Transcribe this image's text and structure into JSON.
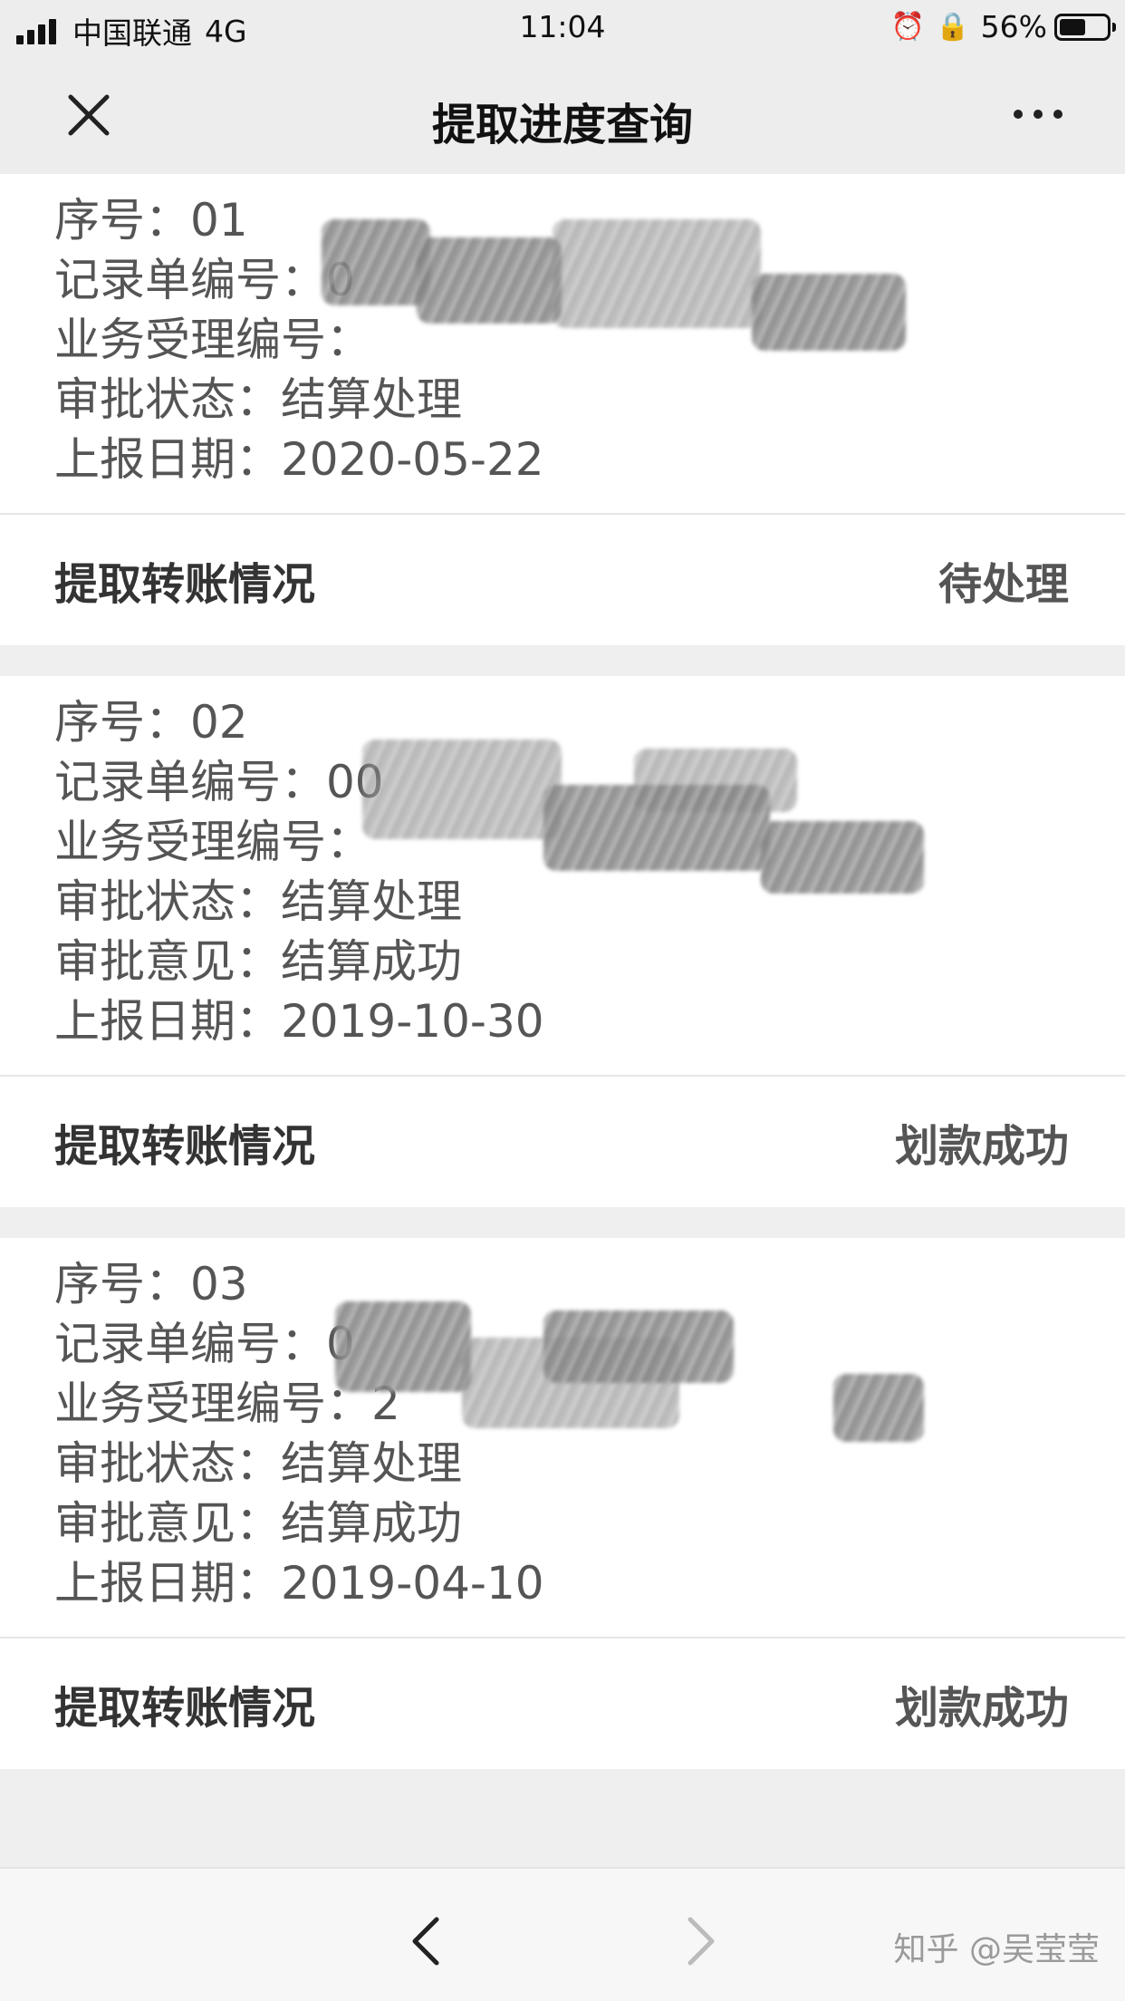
{
  "status_bar": {
    "carrier": "中国联通",
    "network": "4G",
    "time": "11:04",
    "battery_percent_text": "56%",
    "battery_level": 0.56,
    "icons": [
      "signal-icon",
      "alarm-icon",
      "rotation-lock-icon",
      "battery-icon"
    ]
  },
  "nav": {
    "title": "提取进度查询",
    "close_icon": "close-icon",
    "more_icon": "more-icon"
  },
  "records": [
    {
      "fields": [
        {
          "key": "序号：",
          "value": "01"
        },
        {
          "key": "记录单编号：",
          "value": "0"
        },
        {
          "key": "业务受理编号：",
          "value": ""
        },
        {
          "key": "审批状态：",
          "value": "结算处理"
        },
        {
          "key": "上报日期：",
          "value": "2020-05-22"
        }
      ],
      "transfer_label": "提取转账情况",
      "transfer_status": "待处理"
    },
    {
      "fields": [
        {
          "key": "序号：",
          "value": "02"
        },
        {
          "key": "记录单编号：",
          "value": "00"
        },
        {
          "key": "业务受理编号：",
          "value": ""
        },
        {
          "key": "审批状态：",
          "value": "结算处理"
        },
        {
          "key": "审批意见：",
          "value": "结算成功"
        },
        {
          "key": "上报日期：",
          "value": "2019-10-30"
        }
      ],
      "transfer_label": "提取转账情况",
      "transfer_status": "划款成功"
    },
    {
      "fields": [
        {
          "key": "序号：",
          "value": "03"
        },
        {
          "key": "记录单编号：",
          "value": "0"
        },
        {
          "key": "业务受理编号：",
          "value": "2"
        },
        {
          "key": "审批状态：",
          "value": "结算处理"
        },
        {
          "key": "审批意见：",
          "value": "结算成功"
        },
        {
          "key": "上报日期：",
          "value": "2019-04-10"
        }
      ],
      "transfer_label": "提取转账情况",
      "transfer_status": "划款成功"
    }
  ],
  "bottom_bar": {
    "back_icon": "back-arrow-icon",
    "forward_icon": "forward-arrow-icon"
  },
  "watermark": "知乎 @吴莹莹"
}
